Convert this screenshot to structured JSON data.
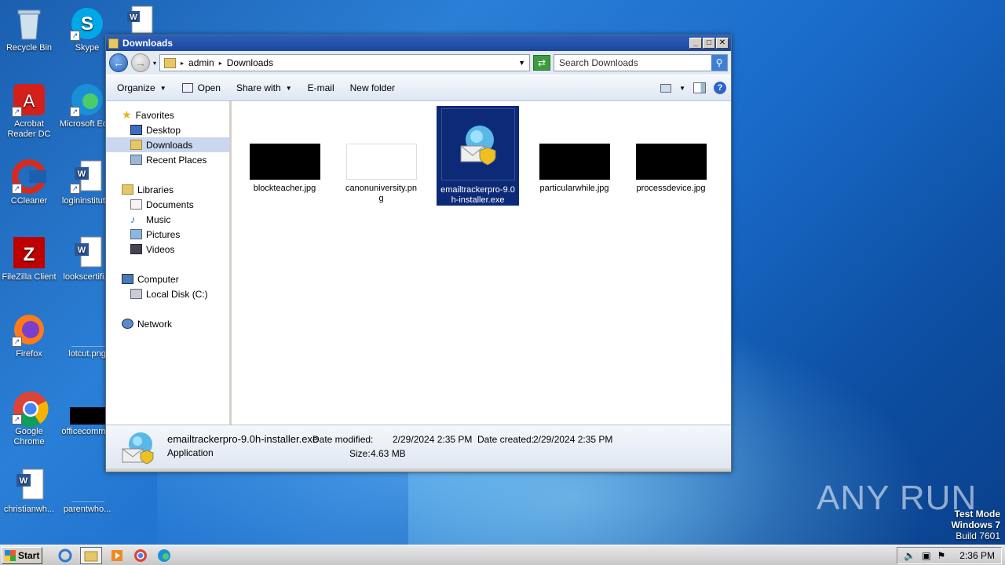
{
  "desktop": {
    "icons": [
      {
        "label": "Recycle Bin"
      },
      {
        "label": "Skype"
      },
      {
        "label": "Acrobat Reader DC"
      },
      {
        "label": "Microsoft Ed..."
      },
      {
        "label": "CCleaner"
      },
      {
        "label": "logininstitut..."
      },
      {
        "label": "FileZilla Client"
      },
      {
        "label": "lookscertifi..."
      },
      {
        "label": "Firefox"
      },
      {
        "label": "lotcut.png"
      },
      {
        "label": "Google Chrome"
      },
      {
        "label": "officecomm..."
      },
      {
        "label": "christianwh..."
      },
      {
        "label": "parentwho..."
      }
    ]
  },
  "window": {
    "title": "Downloads",
    "address": {
      "segments": [
        "admin",
        "Downloads"
      ]
    },
    "search_placeholder": "Search Downloads",
    "toolbar": {
      "organize": "Organize",
      "open": "Open",
      "share_with": "Share with",
      "email": "E-mail",
      "new_folder": "New folder"
    },
    "nav": {
      "favorites": "Favorites",
      "desktop": "Desktop",
      "downloads": "Downloads",
      "recent_places": "Recent Places",
      "libraries": "Libraries",
      "documents": "Documents",
      "music": "Music",
      "pictures": "Pictures",
      "videos": "Videos",
      "computer": "Computer",
      "local_disk": "Local Disk (C:)",
      "network": "Network"
    },
    "files": [
      {
        "name": "blockteacher.jpg"
      },
      {
        "name": "canonuniversity.png"
      },
      {
        "name": "emailtrackerpro-9.0h-installer.exe",
        "selected": true
      },
      {
        "name": "particularwhile.jpg"
      },
      {
        "name": "processdevice.jpg"
      }
    ],
    "details": {
      "name": "emailtrackerpro-9.0h-installer.exe",
      "type": "Application",
      "date_modified_label": "Date modified:",
      "date_modified": "2/29/2024 2:35 PM",
      "date_created_label": "Date created:",
      "date_created": "2/29/2024 2:35 PM",
      "size_label": "Size:",
      "size": "4.63 MB"
    }
  },
  "taskbar": {
    "start": "Start",
    "clock": "2:36 PM"
  },
  "watermark": "ANY RUN",
  "test_mode": {
    "line1": "Test Mode",
    "line2": "Windows 7",
    "line3": "Build 7601"
  }
}
